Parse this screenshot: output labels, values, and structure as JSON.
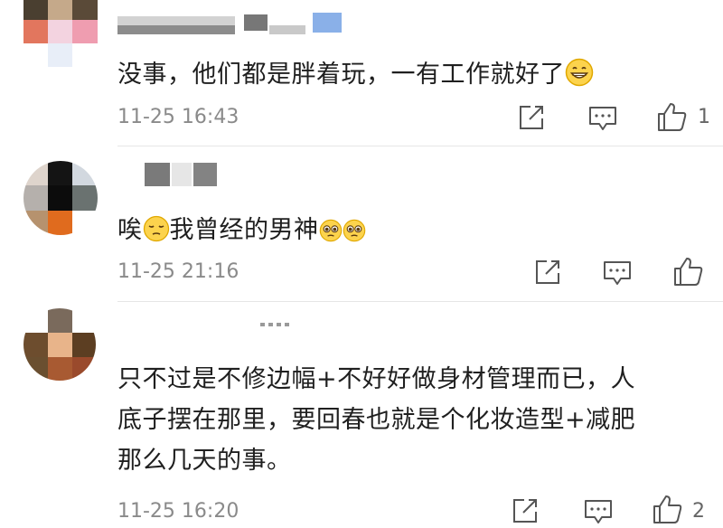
{
  "comments": [
    {
      "text": "没事，他们都是胖着玩，一有工作就好了",
      "emoji_after": "grinning-face-emoji",
      "time": "11-25 16:43",
      "like_count": "1"
    },
    {
      "text_parts": [
        "唉",
        "我曾经的男神"
      ],
      "emojis": [
        "pensive-face-emoji",
        "pleading-face-emoji",
        "pleading-face-emoji"
      ],
      "time": "11-25 21:16",
      "like_count": ""
    },
    {
      "lines": [
        "只不过是不修边幅+不好好做身材管理而已，人",
        "底子摆在那里，要回春也就是个化妆造型+减肥",
        "那么几天的事。"
      ],
      "time": "11-25 16:20",
      "like_count": "2"
    }
  ],
  "icons": {
    "share": "share-icon",
    "reply": "comment-icon",
    "like": "thumbs-up-icon"
  },
  "colors": {
    "text": "#1f1f1f",
    "meta": "#8a8a8a",
    "icon": "#555555",
    "divider": "#e6e6e6"
  }
}
